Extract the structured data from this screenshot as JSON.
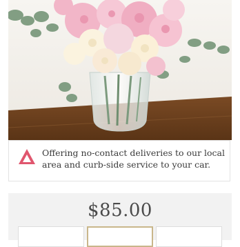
{
  "product_image": {
    "alt_icon": "flower-bouquet-image",
    "colors": {
      "wall": "#f4f1ec",
      "table": "#6b3f1e",
      "pink": "#f2b6c8",
      "cream": "#fbf3df",
      "leaf": "#7c9a7e"
    }
  },
  "notice": {
    "icon": "warning-triangle-icon",
    "icon_color": "#e0566e",
    "text": "Offering no-contact deliveries to our local area and curb-side service to your car."
  },
  "pricing": {
    "price": "$85.00",
    "selected_color": "#c9b68a"
  }
}
